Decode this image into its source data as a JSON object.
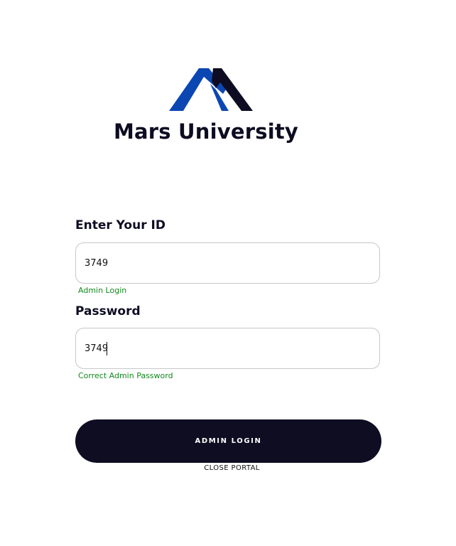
{
  "brand": {
    "name": "Mars University",
    "logo_icon": "mountain-m-logo-icon",
    "colors": {
      "blue": "#0a47b3",
      "navy": "#0d0c22"
    }
  },
  "form": {
    "id_label": "Enter Your ID",
    "id_value": "3749",
    "id_hint": "Admin Login",
    "password_label": "Password",
    "password_value": "3749",
    "password_hint": "Correct Admin Password",
    "hint_color": "#138a1e"
  },
  "actions": {
    "login_label": "ADMIN LOGIN",
    "close_label": "CLOSE PORTAL"
  }
}
